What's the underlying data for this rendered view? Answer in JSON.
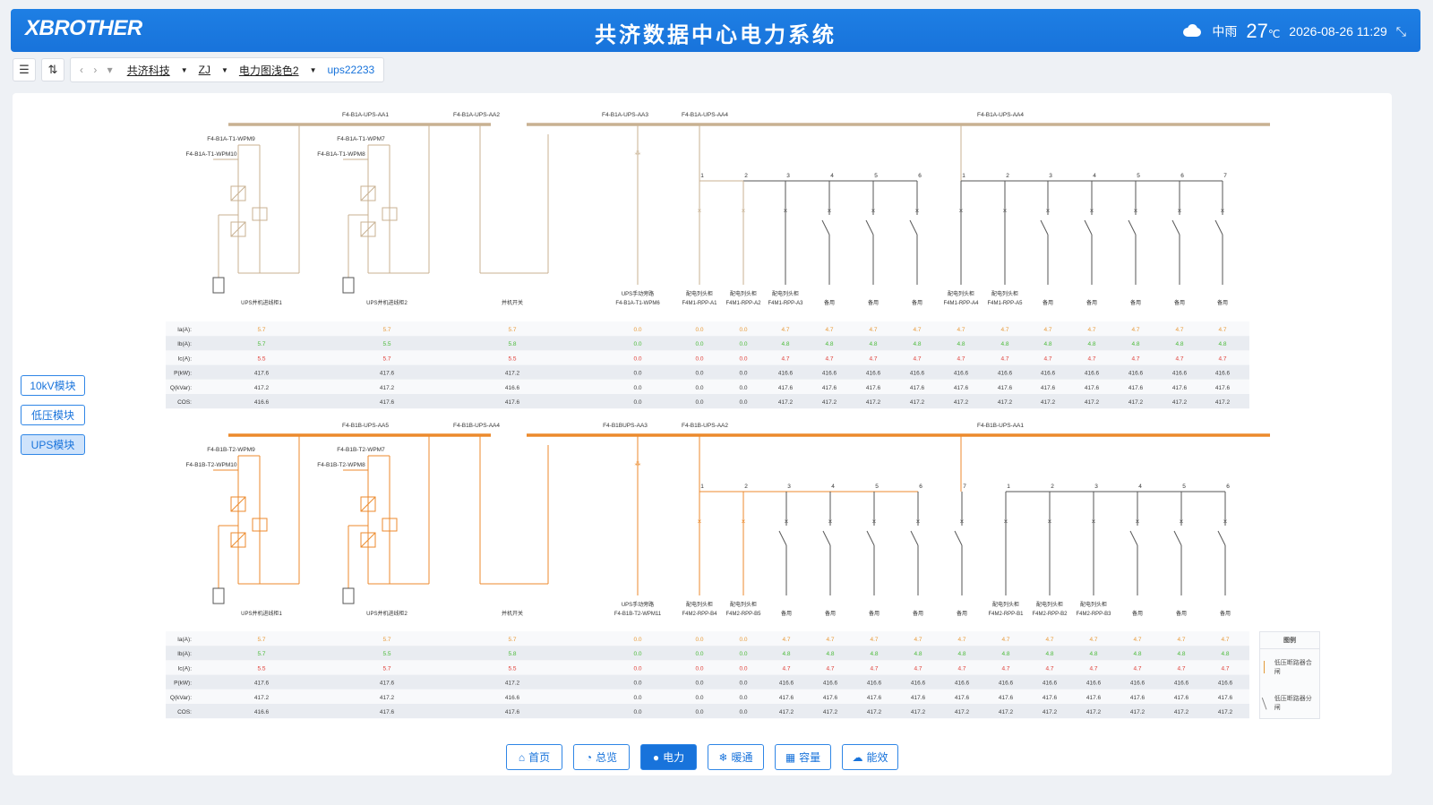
{
  "header": {
    "logo": "XBROTHER",
    "title": "共济数据中心电力系统",
    "weather_text": "中雨",
    "temperature": "27",
    "temperature_unit": "℃",
    "datetime": "2026-08-26 11:29"
  },
  "toolbar": {
    "breadcrumbs": [
      "共济科技",
      "ZJ",
      "电力图浅色2"
    ],
    "current": "ups22233"
  },
  "side_tabs": [
    {
      "label": "10kV模块",
      "active": false
    },
    {
      "label": "低压模块",
      "active": false
    },
    {
      "label": "UPS模块",
      "active": true
    }
  ],
  "bottom_nav": [
    {
      "label": "首页",
      "icon": "home-icon",
      "active": false
    },
    {
      "label": "总览",
      "icon": "dashboard-icon",
      "active": false
    },
    {
      "label": "电力",
      "icon": "power-icon",
      "active": true
    },
    {
      "label": "暖通",
      "icon": "snowflake-icon",
      "active": false
    },
    {
      "label": "容量",
      "icon": "capacity-icon",
      "active": false
    },
    {
      "label": "能效",
      "icon": "cloud-icon",
      "active": false
    }
  ],
  "legend": {
    "title": "图例",
    "items": [
      "低压断路器合闸",
      "低压断路器分闸"
    ]
  },
  "colors": {
    "brand": "#1873db",
    "bus_top": "#c8b192",
    "bus_bottom": "#ec8a2c",
    "ia": "#e89a3a",
    "ib": "#4cbb3a",
    "ic": "#e0413a"
  },
  "row_labels": [
    "Ia(A):",
    "Ib(A):",
    "Ic(A):",
    "P(kW):",
    "Q(kVar):",
    "COS:"
  ],
  "panels": [
    {
      "buses": [
        "F4-B1A-UPS-AA1",
        "F4-B1A-UPS-AA2",
        "F4-B1A-UPS-AA3",
        "F4-B1A-UPS-AA4",
        "F4-B1A-UPS-AA4"
      ],
      "wpm": [
        "F4-B1A-T1-WPM9",
        "F4-B1A-T1-WPM10",
        "F4-B1A-T1-WPM7",
        "F4-B1A-T1-WPM8"
      ],
      "circuits": [
        {
          "name": "UPS并机进线柜1",
          "name2": "",
          "num": "",
          "ia": "5.7",
          "ib": "5.7",
          "ic": "5.5",
          "p": "417.6",
          "q": "417.2",
          "cos": "416.6"
        },
        {
          "name": "UPS并机进线柜2",
          "name2": "",
          "num": "",
          "ia": "5.7",
          "ib": "5.5",
          "ic": "5.7",
          "p": "417.6",
          "q": "417.2",
          "cos": "417.6"
        },
        {
          "name": "并机开关",
          "name2": "",
          "num": "",
          "ia": "5.7",
          "ib": "5.8",
          "ic": "5.5",
          "p": "417.2",
          "q": "416.6",
          "cos": "417.6"
        },
        {
          "name": "UPS手动旁路",
          "name2": "F4-B1A-T1-WPM6",
          "num": "",
          "ia": "0.0",
          "ib": "0.0",
          "ic": "0.0",
          "p": "0.0",
          "q": "0.0",
          "cos": "0.0"
        },
        {
          "name": "配电列头柜",
          "name2": "F4M1-RPP-A1",
          "num": "1",
          "ia": "0.0",
          "ib": "0.0",
          "ic": "0.0",
          "p": "0.0",
          "q": "0.0",
          "cos": "0.0"
        },
        {
          "name": "配电列头柜",
          "name2": "F4M1-RPP-A2",
          "num": "2",
          "ia": "0.0",
          "ib": "0.0",
          "ic": "0.0",
          "p": "0.0",
          "q": "0.0",
          "cos": "0.0"
        },
        {
          "name": "配电列头柜",
          "name2": "F4M1-RPP-A3",
          "num": "3",
          "ia": "4.7",
          "ib": "4.8",
          "ic": "4.7",
          "p": "416.6",
          "q": "417.6",
          "cos": "417.2"
        },
        {
          "name": "备用",
          "name2": "",
          "num": "4",
          "ia": "4.7",
          "ib": "4.8",
          "ic": "4.7",
          "p": "416.6",
          "q": "417.6",
          "cos": "417.2"
        },
        {
          "name": "备用",
          "name2": "",
          "num": "5",
          "ia": "4.7",
          "ib": "4.8",
          "ic": "4.7",
          "p": "416.6",
          "q": "417.6",
          "cos": "417.2"
        },
        {
          "name": "备用",
          "name2": "",
          "num": "6",
          "ia": "4.7",
          "ib": "4.8",
          "ic": "4.7",
          "p": "416.6",
          "q": "417.6",
          "cos": "417.2"
        },
        {
          "name": "配电列头柜",
          "name2": "F4M1-RPP-A4",
          "num": "1",
          "ia": "4.7",
          "ib": "4.8",
          "ic": "4.7",
          "p": "416.6",
          "q": "417.6",
          "cos": "417.2"
        },
        {
          "name": "配电列头柜",
          "name2": "F4M1-RPP-A5",
          "num": "2",
          "ia": "4.7",
          "ib": "4.8",
          "ic": "4.7",
          "p": "416.6",
          "q": "417.6",
          "cos": "417.2"
        },
        {
          "name": "备用",
          "name2": "",
          "num": "3",
          "ia": "4.7",
          "ib": "4.8",
          "ic": "4.7",
          "p": "416.6",
          "q": "417.6",
          "cos": "417.2"
        },
        {
          "name": "备用",
          "name2": "",
          "num": "4",
          "ia": "4.7",
          "ib": "4.8",
          "ic": "4.7",
          "p": "416.6",
          "q": "417.6",
          "cos": "417.2"
        },
        {
          "name": "备用",
          "name2": "",
          "num": "5",
          "ia": "4.7",
          "ib": "4.8",
          "ic": "4.7",
          "p": "416.6",
          "q": "417.6",
          "cos": "417.2"
        },
        {
          "name": "备用",
          "name2": "",
          "num": "6",
          "ia": "4.7",
          "ib": "4.8",
          "ic": "4.7",
          "p": "416.6",
          "q": "417.6",
          "cos": "417.2"
        },
        {
          "name": "备用",
          "name2": "",
          "num": "7",
          "ia": "4.7",
          "ib": "4.8",
          "ic": "4.7",
          "p": "416.6",
          "q": "417.6",
          "cos": "417.2"
        }
      ]
    },
    {
      "buses": [
        "F4-B1B-UPS-AA5",
        "F4-B1B-UPS-AA4",
        "F4-B1BUPS-AA3",
        "F4-B1B-UPS-AA2",
        "F4-B1B-UPS-AA1"
      ],
      "wpm": [
        "F4-B1B-T2-WPM9",
        "F4-B1B-T2-WPM10",
        "F4-B1B-T2-WPM7",
        "F4-B1B-T2-WPM8"
      ],
      "circuits": [
        {
          "name": "UPS并机进线柜1",
          "name2": "",
          "num": "",
          "ia": "5.7",
          "ib": "5.7",
          "ic": "5.5",
          "p": "417.6",
          "q": "417.2",
          "cos": "416.6"
        },
        {
          "name": "UPS并机进线柜2",
          "name2": "",
          "num": "",
          "ia": "5.7",
          "ib": "5.5",
          "ic": "5.7",
          "p": "417.6",
          "q": "417.2",
          "cos": "417.6"
        },
        {
          "name": "并机开关",
          "name2": "",
          "num": "",
          "ia": "5.7",
          "ib": "5.8",
          "ic": "5.5",
          "p": "417.2",
          "q": "416.6",
          "cos": "417.6"
        },
        {
          "name": "UPS手动旁路",
          "name2": "F4-B1B-T2-WPM11",
          "num": "",
          "ia": "0.0",
          "ib": "0.0",
          "ic": "0.0",
          "p": "0.0",
          "q": "0.0",
          "cos": "0.0"
        },
        {
          "name": "配电列头柜",
          "name2": "F4M2-RPP-B4",
          "num": "1",
          "ia": "0.0",
          "ib": "0.0",
          "ic": "0.0",
          "p": "0.0",
          "q": "0.0",
          "cos": "0.0"
        },
        {
          "name": "配电列头柜",
          "name2": "F4M2-RPP-B5",
          "num": "2",
          "ia": "0.0",
          "ib": "0.0",
          "ic": "0.0",
          "p": "0.0",
          "q": "0.0",
          "cos": "0.0"
        },
        {
          "name": "备用",
          "name2": "",
          "num": "3",
          "ia": "4.7",
          "ib": "4.8",
          "ic": "4.7",
          "p": "416.6",
          "q": "417.6",
          "cos": "417.2"
        },
        {
          "name": "备用",
          "name2": "",
          "num": "4",
          "ia": "4.7",
          "ib": "4.8",
          "ic": "4.7",
          "p": "416.6",
          "q": "417.6",
          "cos": "417.2"
        },
        {
          "name": "备用",
          "name2": "",
          "num": "5",
          "ia": "4.7",
          "ib": "4.8",
          "ic": "4.7",
          "p": "416.6",
          "q": "417.6",
          "cos": "417.2"
        },
        {
          "name": "备用",
          "name2": "",
          "num": "6",
          "ia": "4.7",
          "ib": "4.8",
          "ic": "4.7",
          "p": "416.6",
          "q": "417.6",
          "cos": "417.2"
        },
        {
          "name": "备用",
          "name2": "",
          "num": "7",
          "ia": "4.7",
          "ib": "4.8",
          "ic": "4.7",
          "p": "416.6",
          "q": "417.6",
          "cos": "417.2"
        },
        {
          "name": "配电列头柜",
          "name2": "F4M2-RPP-B1",
          "num": "1",
          "ia": "4.7",
          "ib": "4.8",
          "ic": "4.7",
          "p": "416.6",
          "q": "417.6",
          "cos": "417.2"
        },
        {
          "name": "配电列头柜",
          "name2": "F4M2-RPP-B2",
          "num": "2",
          "ia": "4.7",
          "ib": "4.8",
          "ic": "4.7",
          "p": "416.6",
          "q": "417.6",
          "cos": "417.2"
        },
        {
          "name": "配电列头柜",
          "name2": "F4M2-RPP-B3",
          "num": "3",
          "ia": "4.7",
          "ib": "4.8",
          "ic": "4.7",
          "p": "416.6",
          "q": "417.6",
          "cos": "417.2"
        },
        {
          "name": "备用",
          "name2": "",
          "num": "4",
          "ia": "4.7",
          "ib": "4.8",
          "ic": "4.7",
          "p": "416.6",
          "q": "417.6",
          "cos": "417.2"
        },
        {
          "name": "备用",
          "name2": "",
          "num": "5",
          "ia": "4.7",
          "ib": "4.8",
          "ic": "4.7",
          "p": "416.6",
          "q": "417.6",
          "cos": "417.2"
        },
        {
          "name": "备用",
          "name2": "",
          "num": "6",
          "ia": "4.7",
          "ib": "4.8",
          "ic": "4.7",
          "p": "416.6",
          "q": "417.6",
          "cos": "417.2"
        }
      ]
    }
  ]
}
